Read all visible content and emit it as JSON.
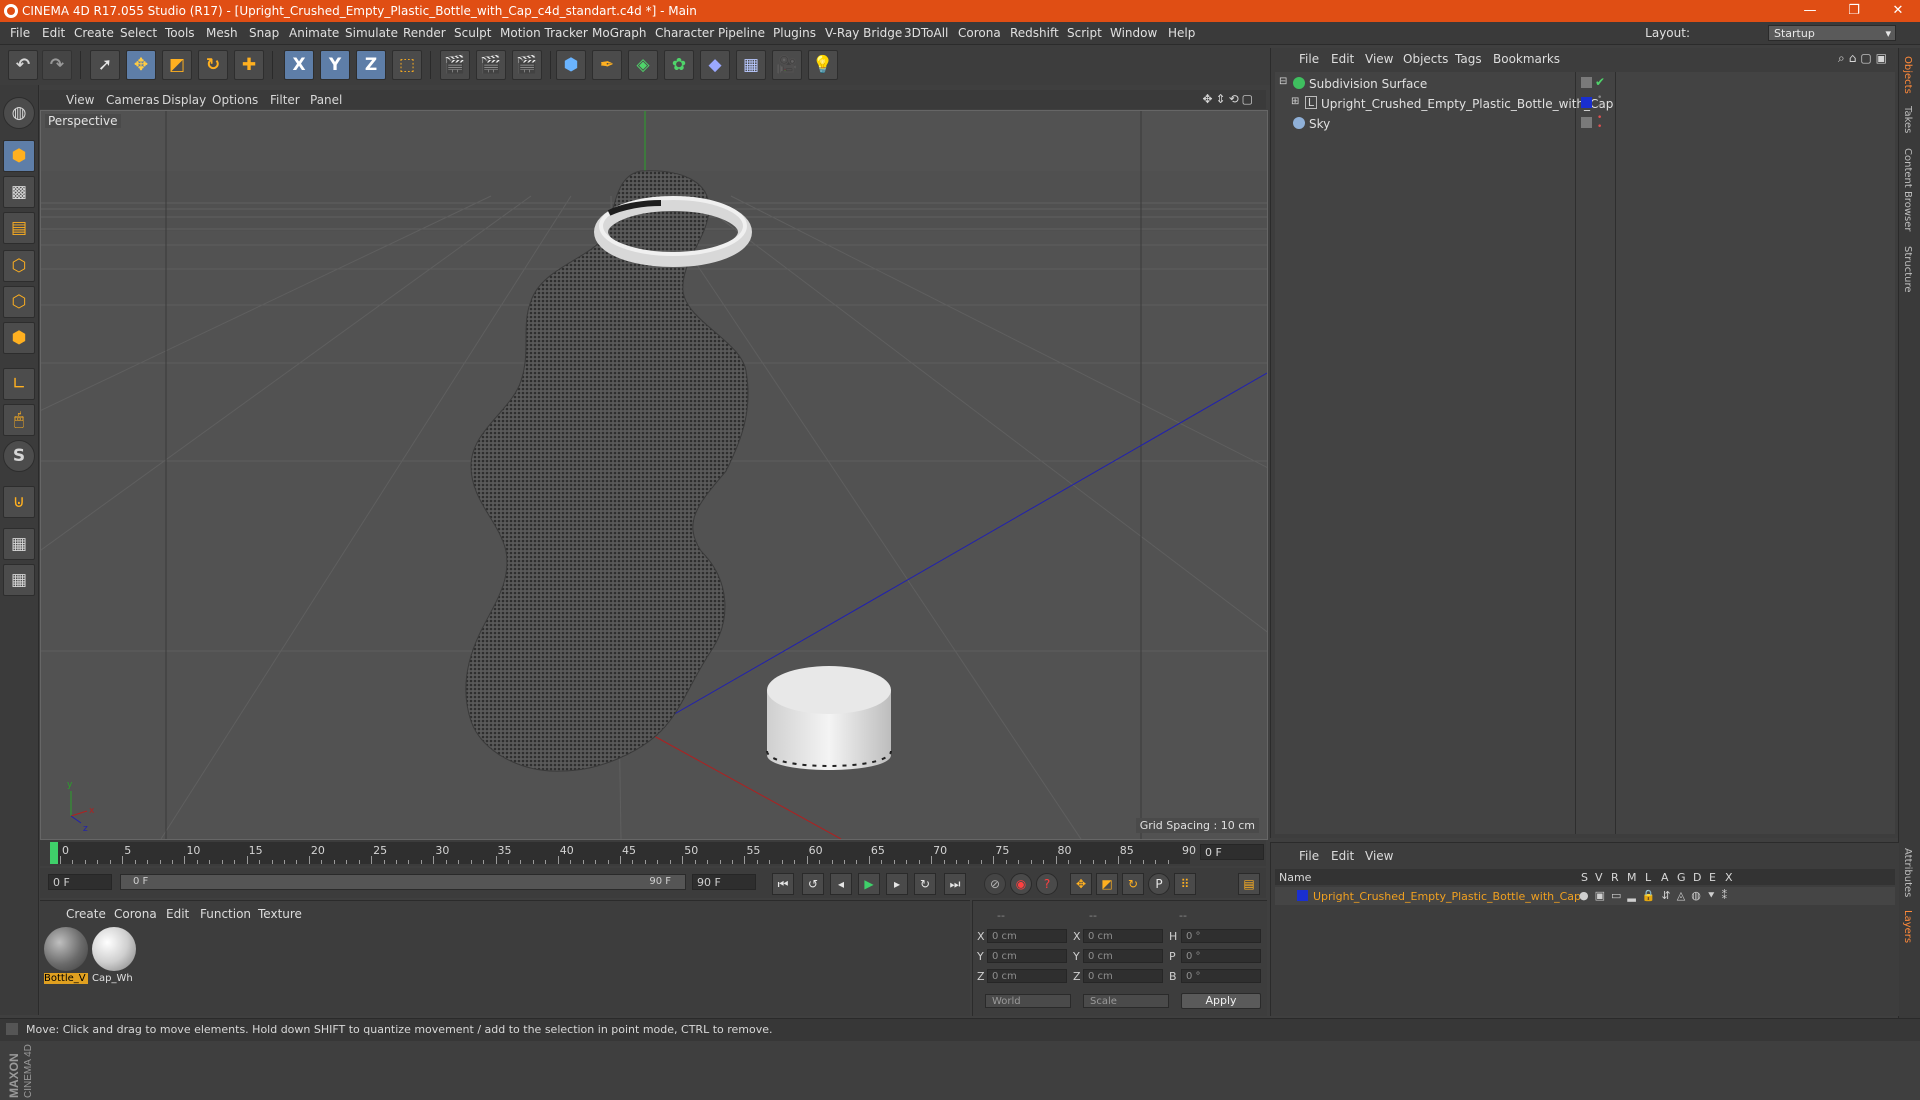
{
  "window": {
    "title": "CINEMA 4D R17.055 Studio (R17) - [Upright_Crushed_Empty_Plastic_Bottle_with_Cap_c4d_standart.c4d *] - Main",
    "minimize": "—",
    "restore": "❐",
    "close": "✕"
  },
  "menu": [
    "File",
    "Edit",
    "Create",
    "Select",
    "Tools",
    "Mesh",
    "Snap",
    "Animate",
    "Simulate",
    "Render",
    "Sculpt",
    "Motion Tracker",
    "MoGraph",
    "Character",
    "Pipeline",
    "Plugins",
    "V-Ray Bridge",
    "3DToAll",
    "Corona",
    "Redshift",
    "Script",
    "Window",
    "Help"
  ],
  "layout": {
    "label": "Layout:",
    "value": "Startup"
  },
  "toolbar": {
    "axes": [
      "X",
      "Y",
      "Z"
    ]
  },
  "viewport": {
    "menu": [
      "View",
      "Cameras",
      "Display",
      "Options",
      "Filter",
      "Panel"
    ],
    "label": "Perspective",
    "grid_spacing": "Grid Spacing : 10 cm"
  },
  "objects": {
    "menu": [
      "File",
      "Edit",
      "View",
      "Objects",
      "Tags",
      "Bookmarks"
    ],
    "items": [
      {
        "name": "Subdivision Surface",
        "color": "#3fbf5f"
      },
      {
        "name": "Upright_Crushed_Empty_Plastic_Bottle_with_Cap",
        "color": "#a0a0a0"
      },
      {
        "name": "Sky",
        "color": "#8fb0d8"
      }
    ],
    "layer_color": "#1a2fd0"
  },
  "side_tabs": [
    "Objects",
    "Takes",
    "Content Browser",
    "Structure"
  ],
  "side_tabs_bottom": [
    "Attributes",
    "Layers"
  ],
  "timeline": {
    "ticks": [
      "0",
      "5",
      "10",
      "15",
      "20",
      "25",
      "30",
      "35",
      "40",
      "45",
      "50",
      "55",
      "60",
      "65",
      "70",
      "75",
      "80",
      "85",
      "90"
    ],
    "current": "0 F"
  },
  "transport": {
    "start": "0 F",
    "range_start": "0 F",
    "range_end": "90 F",
    "end": "90 F"
  },
  "materials": {
    "menu": [
      "Create",
      "Corona",
      "Edit",
      "Function",
      "Texture"
    ],
    "items": [
      {
        "name": "Bottle_V",
        "selected": true
      },
      {
        "name": "Cap_Wh",
        "selected": false
      }
    ]
  },
  "coords": {
    "header": [
      "--",
      "--",
      "--"
    ],
    "rows": [
      {
        "l1": "X",
        "v1": "0 cm",
        "l2": "X",
        "v2": "0 cm",
        "l3": "H",
        "v3": "0 °"
      },
      {
        "l1": "Y",
        "v1": "0 cm",
        "l2": "Y",
        "v2": "0 cm",
        "l3": "P",
        "v3": "0 °"
      },
      {
        "l1": "Z",
        "v1": "0 cm",
        "l2": "Z",
        "v2": "0 cm",
        "l3": "B",
        "v3": "0 °"
      }
    ],
    "mode1": "World",
    "mode2": "Scale",
    "apply": "Apply"
  },
  "layers": {
    "menu": [
      "File",
      "Edit",
      "View"
    ],
    "columns": [
      "Name",
      "S",
      "V",
      "R",
      "M",
      "L",
      "A",
      "G",
      "D",
      "E",
      "X"
    ],
    "row_name": "Upright_Crushed_Empty_Plastic_Bottle_with_Cap"
  },
  "status": "Move: Click and drag to move elements. Hold down SHIFT to quantize movement / add to the selection in point mode, CTRL to remove.",
  "brand": "MAXON CINEMA 4D"
}
